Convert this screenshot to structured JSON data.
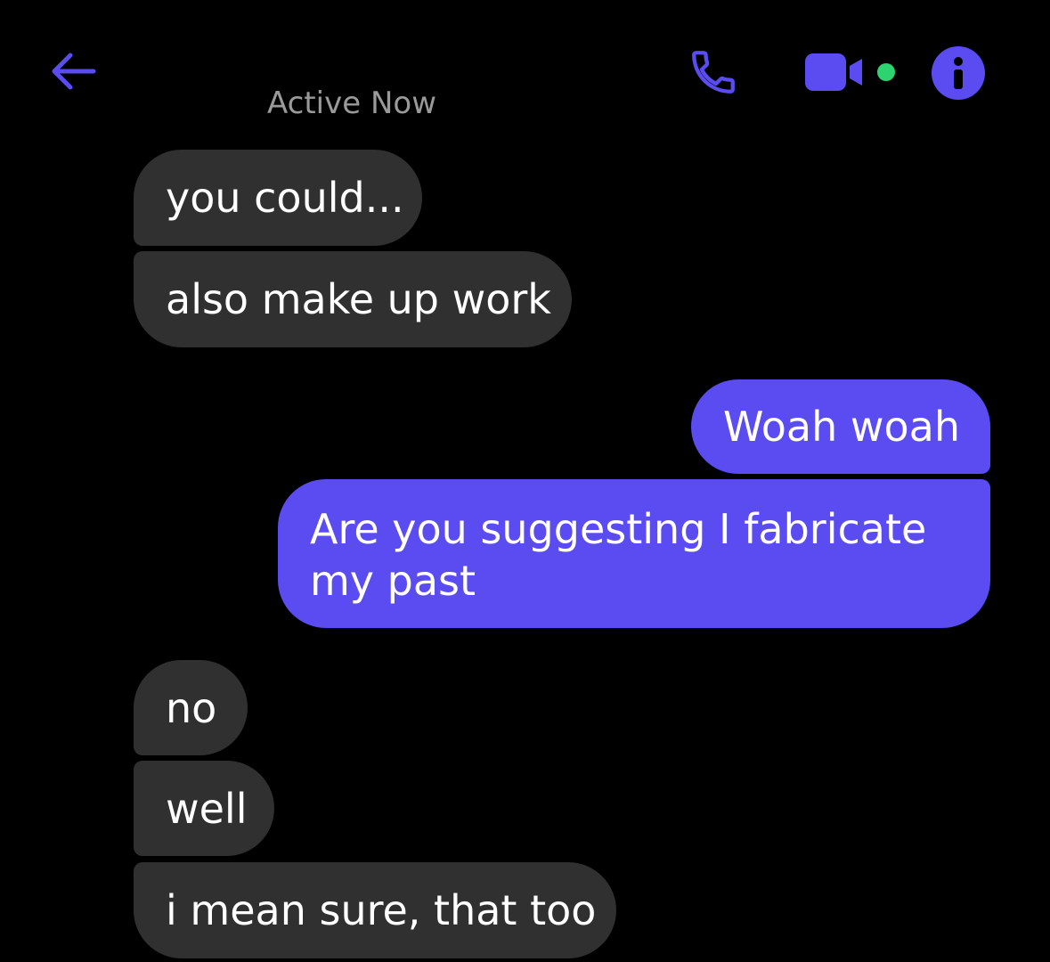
{
  "header": {
    "status": "Active Now",
    "icons": {
      "back": "arrow-left-icon",
      "call": "phone-icon",
      "video": "video-camera-icon",
      "info": "info-icon"
    },
    "colors": {
      "accent": "#5a4cf0",
      "active": "#2dd36f",
      "incoming_bubble": "#303030",
      "status_text": "#9a9a9a"
    }
  },
  "messages": [
    {
      "side": "incoming",
      "text": "you could..."
    },
    {
      "side": "incoming",
      "text": "also make up work"
    },
    {
      "side": "outgoing",
      "text": "Woah woah"
    },
    {
      "side": "outgoing",
      "text": "Are you suggesting I fabricate my past"
    },
    {
      "side": "incoming",
      "text": "no"
    },
    {
      "side": "incoming",
      "text": "well"
    },
    {
      "side": "incoming",
      "text": "i mean sure, that too"
    }
  ]
}
